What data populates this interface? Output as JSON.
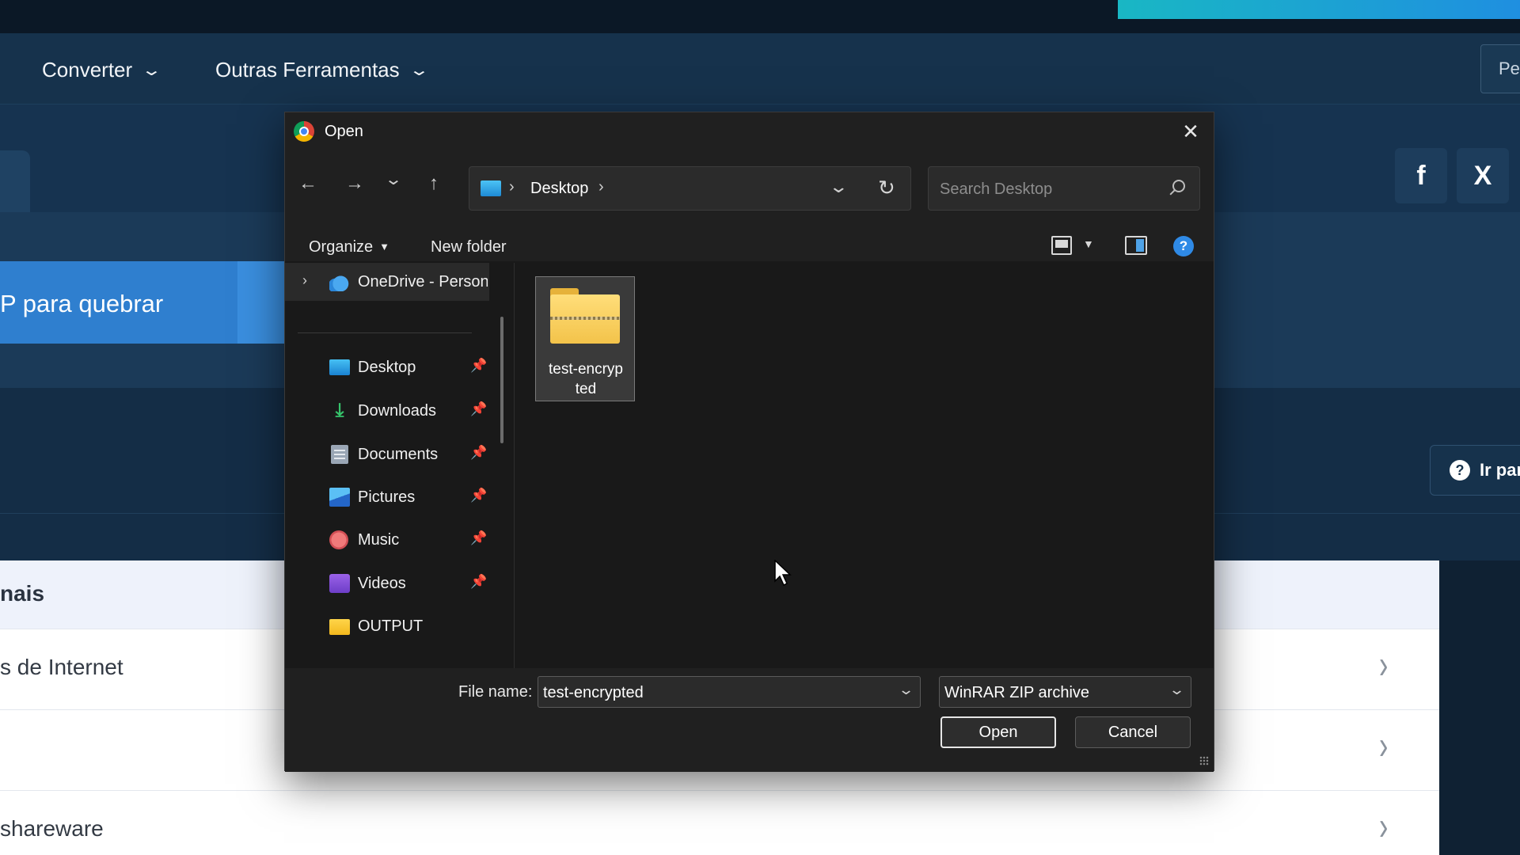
{
  "website": {
    "nav": [
      {
        "label": "Converter"
      },
      {
        "label": "Outras Ferramentas"
      }
    ],
    "nav_right_button": "Pe",
    "hero_button": "P para quebrar",
    "social": {
      "facebook": "f",
      "x": "X"
    },
    "help_button": "Ir par",
    "card_title": "nais",
    "rows": [
      {
        "text": "s de Internet"
      },
      {
        "text": ""
      },
      {
        "text": "shareware"
      }
    ]
  },
  "dialog": {
    "title": "Open",
    "address": {
      "location": "Desktop"
    },
    "search": {
      "placeholder": "Search Desktop"
    },
    "commands": {
      "organize": "Organize",
      "new_folder": "New folder"
    },
    "nav_pane": {
      "onedrive": "OneDrive - Personal",
      "items": [
        {
          "label": "Desktop",
          "icon": "desktop-icon"
        },
        {
          "label": "Downloads",
          "icon": "download-icon"
        },
        {
          "label": "Documents",
          "icon": "documents-icon"
        },
        {
          "label": "Pictures",
          "icon": "pictures-icon"
        },
        {
          "label": "Music",
          "icon": "music-icon"
        },
        {
          "label": "Videos",
          "icon": "videos-icon"
        },
        {
          "label": "OUTPUT",
          "icon": "folder-icon"
        }
      ]
    },
    "files": [
      {
        "name": "test-encryp\nted",
        "icon": "zip-folder-icon"
      }
    ],
    "footer": {
      "file_name_label": "File name:",
      "file_name_value": "test-encrypted",
      "file_type": "WinRAR ZIP archive",
      "open_label": "Open",
      "cancel_label": "Cancel"
    }
  }
}
